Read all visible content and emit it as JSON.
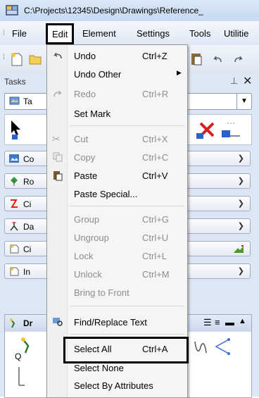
{
  "window": {
    "title": "C:\\Projects\\12345\\Design\\Drawings\\Reference_"
  },
  "menubar": {
    "items": [
      {
        "label": "File"
      },
      {
        "label": "Edit"
      },
      {
        "label": "Element"
      },
      {
        "label": "Settings"
      },
      {
        "label": "Tools"
      },
      {
        "label": "Utilitie"
      }
    ]
  },
  "tasks": {
    "header": "Tasks",
    "dropdown_label": "Ta",
    "rows": [
      {
        "label": "Co"
      },
      {
        "label": "Ro"
      },
      {
        "label": "Ci"
      },
      {
        "label": "Da"
      },
      {
        "label": "Ci"
      },
      {
        "label": "In"
      }
    ],
    "drawing_panel_label": "Dr",
    "side_label": "Q"
  },
  "edit_menu": {
    "items": [
      {
        "label": "Undo",
        "shortcut": "Ctrl+Z",
        "enabled": true
      },
      {
        "label": "Undo Other",
        "shortcut": "",
        "enabled": true,
        "submenu": true
      },
      {
        "label": "Redo",
        "shortcut": "Ctrl+R",
        "enabled": false
      },
      {
        "label": "Set Mark",
        "shortcut": "",
        "enabled": true
      },
      {
        "label": "Cut",
        "shortcut": "Ctrl+X",
        "enabled": false
      },
      {
        "label": "Copy",
        "shortcut": "Ctrl+C",
        "enabled": false
      },
      {
        "label": "Paste",
        "shortcut": "Ctrl+V",
        "enabled": true
      },
      {
        "label": "Paste Special...",
        "shortcut": "",
        "enabled": true
      },
      {
        "label": "Group",
        "shortcut": "Ctrl+G",
        "enabled": false
      },
      {
        "label": "Ungroup",
        "shortcut": "Ctrl+U",
        "enabled": false
      },
      {
        "label": "Lock",
        "shortcut": "Ctrl+L",
        "enabled": false
      },
      {
        "label": "Unlock",
        "shortcut": "Ctrl+M",
        "enabled": false
      },
      {
        "label": "Bring to Front",
        "shortcut": "",
        "enabled": false
      },
      {
        "label": "Find/Replace Text",
        "shortcut": "",
        "enabled": true
      },
      {
        "label": "Select All",
        "shortcut": "Ctrl+A",
        "enabled": true
      },
      {
        "label": "Select None",
        "shortcut": "",
        "enabled": true
      },
      {
        "label": "Select By Attributes",
        "shortcut": "",
        "enabled": true
      }
    ]
  }
}
